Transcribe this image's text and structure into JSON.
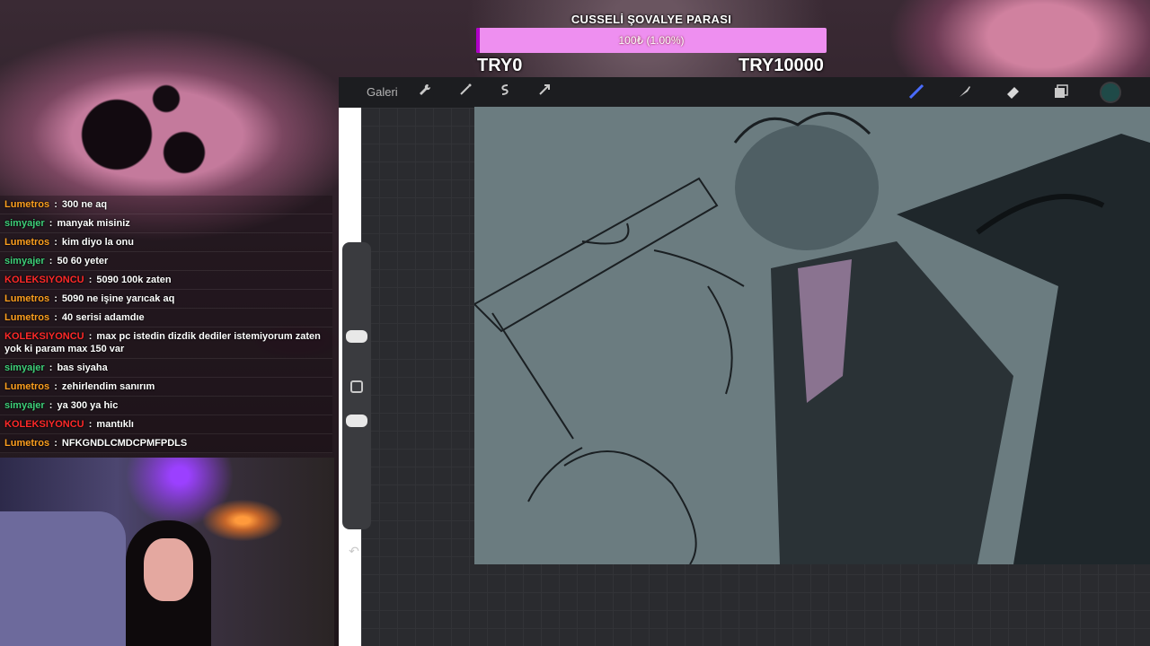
{
  "goal": {
    "title": "CUSSELİ ŞOVALYE PARASI",
    "progress_text": "100₺ (1.00%)",
    "progress_fraction": 0.01,
    "min_label": "TRY0",
    "max_label": "TRY10000",
    "colors": {
      "bar": "#ee8ff0",
      "fill": "#b000c8"
    }
  },
  "app": {
    "gallery_label": "Galeri",
    "left_icons": [
      "wrench-icon",
      "magic-wand-icon",
      "selection-icon",
      "transform-arrow-icon"
    ],
    "right_icons": [
      "brush-icon",
      "smudge-icon",
      "eraser-icon",
      "layers-icon"
    ],
    "current_color": "#1f4a48"
  },
  "chat": {
    "messages": [
      {
        "user": "Lumetros",
        "color": "#ffa020",
        "text": "300 ne aq"
      },
      {
        "user": "simyajer",
        "color": "#3fd07a",
        "text": "manyak misiniz"
      },
      {
        "user": "Lumetros",
        "color": "#ffa020",
        "text": "kim diyo la onu"
      },
      {
        "user": "simyajer",
        "color": "#3fd07a",
        "text": "50 60 yeter"
      },
      {
        "user": "KOLEKSIYONCU",
        "color": "#ff2a2a",
        "text": "5090 100k zaten"
      },
      {
        "user": "Lumetros",
        "color": "#ffa020",
        "text": "5090 ne işine yarıcak aq"
      },
      {
        "user": "Lumetros",
        "color": "#ffa020",
        "text": "40 serisi adamdıe"
      },
      {
        "user": "KOLEKSIYONCU",
        "color": "#ff2a2a",
        "text": "max pc istedin dizdik dediler istemiyorum zaten yok ki param max 150 var"
      },
      {
        "user": "simyajer",
        "color": "#3fd07a",
        "text": "bas siyaha"
      },
      {
        "user": "Lumetros",
        "color": "#ffa020",
        "text": "zehirlendim sanırım"
      },
      {
        "user": "simyajer",
        "color": "#3fd07a",
        "text": "ya 300 ya hic"
      },
      {
        "user": "KOLEKSIYONCU",
        "color": "#ff2a2a",
        "text": "mantıklı"
      },
      {
        "user": "Lumetros",
        "color": "#ffa020",
        "text": "NFKGNDLCMDCPMFPDLS"
      }
    ]
  }
}
